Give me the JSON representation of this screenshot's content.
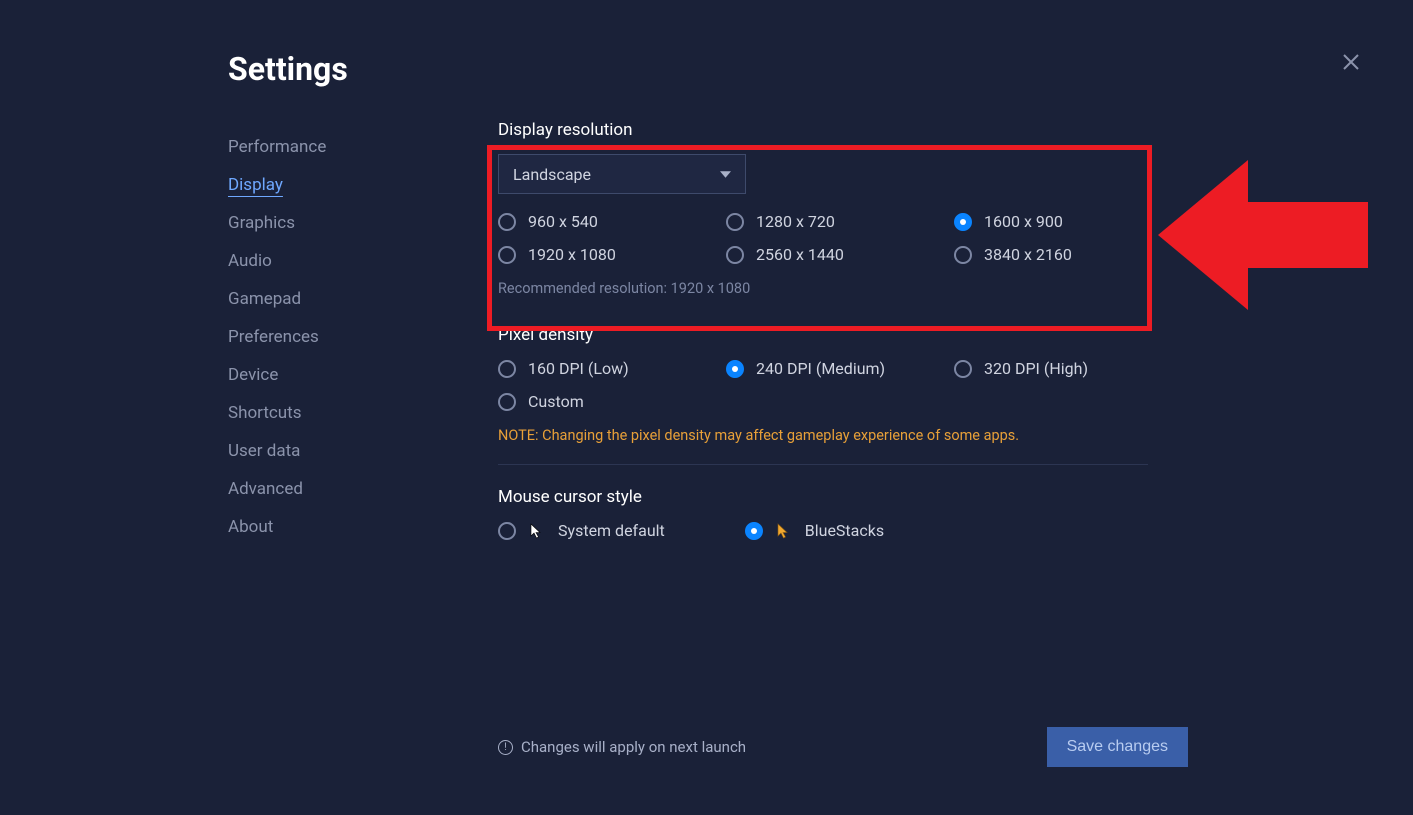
{
  "title": "Settings",
  "sidebar": {
    "items": [
      {
        "label": "Performance",
        "active": false
      },
      {
        "label": "Display",
        "active": true
      },
      {
        "label": "Graphics",
        "active": false
      },
      {
        "label": "Audio",
        "active": false
      },
      {
        "label": "Gamepad",
        "active": false
      },
      {
        "label": "Preferences",
        "active": false
      },
      {
        "label": "Device",
        "active": false
      },
      {
        "label": "Shortcuts",
        "active": false
      },
      {
        "label": "User data",
        "active": false
      },
      {
        "label": "Advanced",
        "active": false
      },
      {
        "label": "About",
        "active": false
      }
    ]
  },
  "resolution": {
    "title": "Display resolution",
    "orientation": "Landscape",
    "options": [
      {
        "label": "960 x 540"
      },
      {
        "label": "1280 x 720"
      },
      {
        "label": "1600 x 900",
        "selected": true
      },
      {
        "label": "1920 x 1080"
      },
      {
        "label": "2560 x 1440"
      },
      {
        "label": "3840 x 2160"
      }
    ],
    "recommended": "Recommended resolution: 1920 x 1080"
  },
  "pixelDensity": {
    "title": "Pixel density",
    "options": [
      {
        "label": "160 DPI (Low)"
      },
      {
        "label": "240 DPI (Medium)",
        "selected": true
      },
      {
        "label": "320 DPI (High)"
      },
      {
        "label": "Custom"
      }
    ],
    "note": "NOTE: Changing the pixel density may affect gameplay experience of some apps."
  },
  "cursorStyle": {
    "title": "Mouse cursor style",
    "options": [
      {
        "label": "System default"
      },
      {
        "label": "BlueStacks",
        "selected": true
      }
    ]
  },
  "footer": {
    "message": "Changes will apply on next launch",
    "save": "Save changes"
  }
}
